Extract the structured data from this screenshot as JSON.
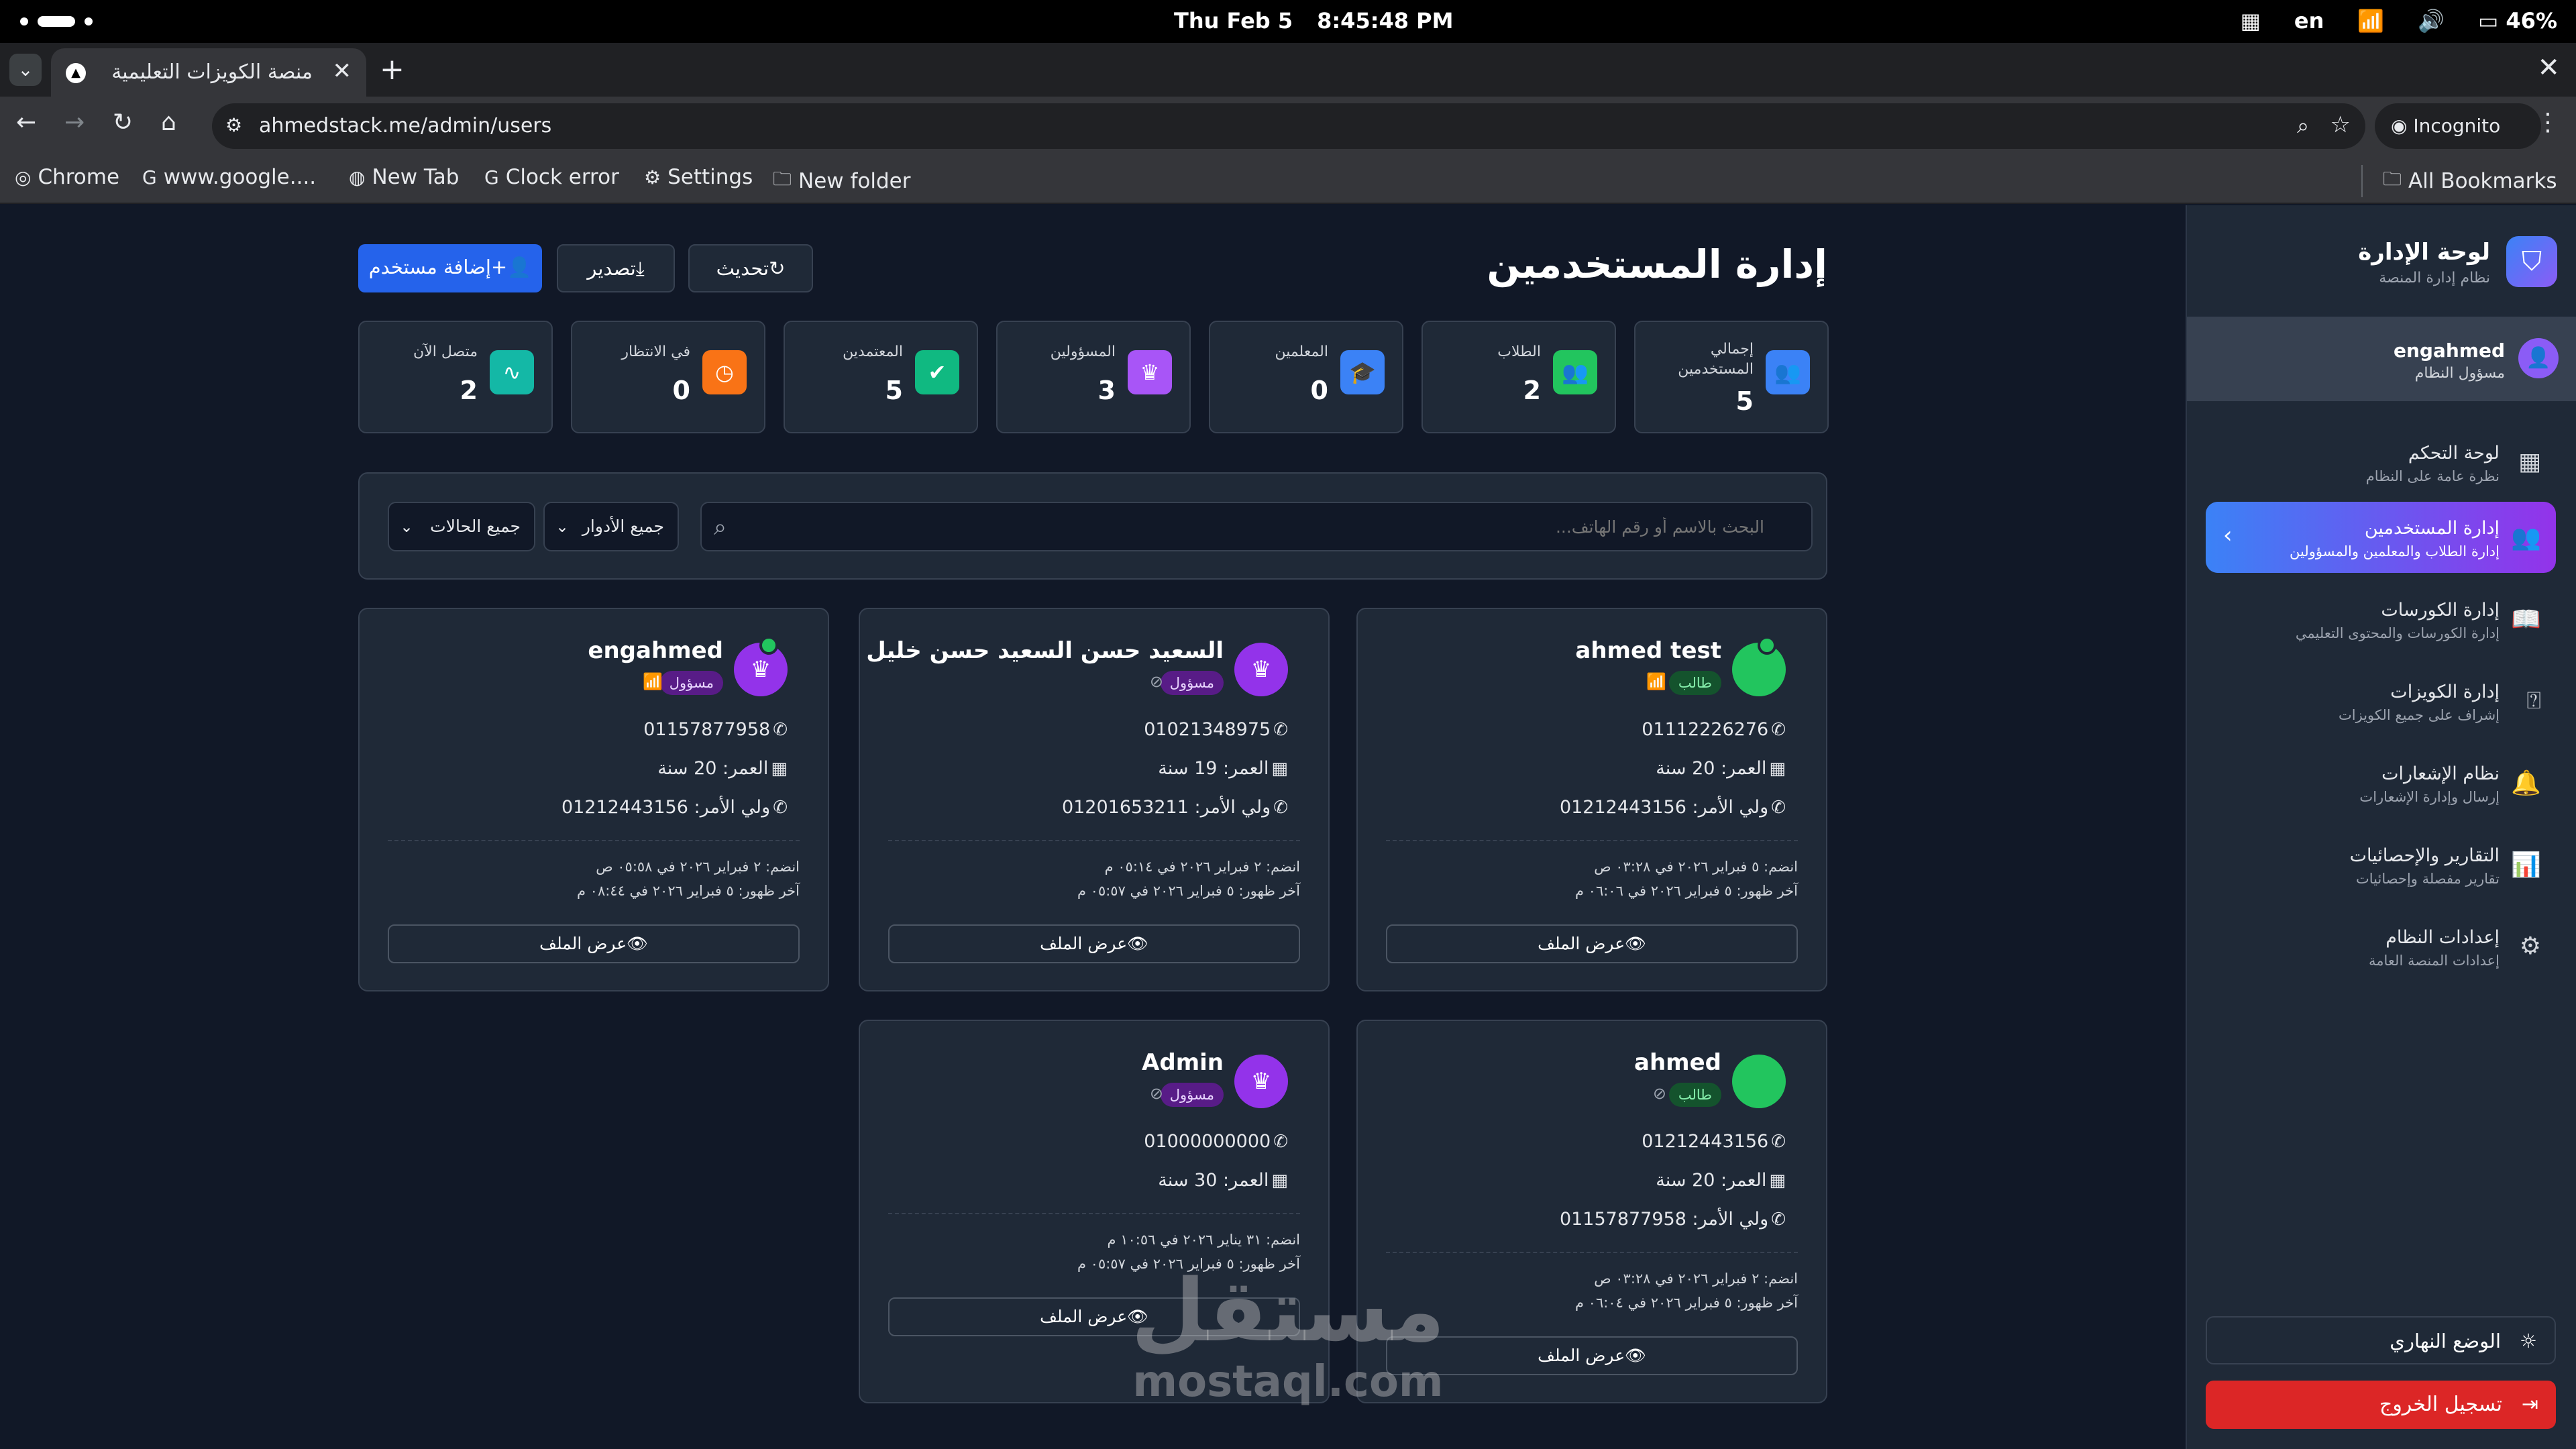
{
  "os": {
    "date": "Thu Feb 5",
    "time": "8:45:48 PM",
    "lang": "en",
    "battery": "46%"
  },
  "browser": {
    "tab_title": "منصة الكويزات التعليمية",
    "url": "ahmedstack.me/admin/users",
    "incognito": "Incognito",
    "bookmarks": [
      "Chrome",
      "www.google....",
      "New Tab",
      "Clock error",
      "Settings",
      "New folder"
    ],
    "all_bookmarks": "All Bookmarks"
  },
  "sidebar": {
    "title": "لوحة الإدارة",
    "subtitle": "نظام إدارة المنصة",
    "user": {
      "name": "engahmed",
      "role": "مسؤول النظام"
    },
    "items": [
      {
        "label": "لوحة التحكم",
        "desc": "نظرة عامة على النظام",
        "icon": "grid-icon",
        "active": false
      },
      {
        "label": "إدارة المستخدمين",
        "desc": "إدارة الطلاب والمعلمين والمسؤولين",
        "icon": "users-icon",
        "active": true
      },
      {
        "label": "إدارة الكورسات",
        "desc": "إدارة الكورسات والمحتوى التعليمي",
        "icon": "book-icon",
        "active": false
      },
      {
        "label": "إدارة الكويزات",
        "desc": "إشراف على جميع الكويزات",
        "icon": "quiz-icon",
        "active": false
      },
      {
        "label": "نظام الإشعارات",
        "desc": "إرسال وإدارة الإشعارات",
        "icon": "bell-icon",
        "active": false
      },
      {
        "label": "التقارير والإحصائيات",
        "desc": "تقارير مفصلة وإحصائيات",
        "icon": "chart-icon",
        "active": false
      },
      {
        "label": "إعدادات النظام",
        "desc": "إعدادات المنصة العامة",
        "icon": "gear-icon",
        "active": false
      }
    ],
    "theme_label": "الوضع النهاري",
    "logout_label": "تسجيل الخروج"
  },
  "header": {
    "title": "إدارة المستخدمين",
    "refresh": "تحديث",
    "export": "تصدير",
    "add_user": "إضافة مستخدم"
  },
  "stats": [
    {
      "label": "إجمالي المستخدمين",
      "value": "5",
      "color": "#3b82f6",
      "icon": "users-icon"
    },
    {
      "label": "الطلاب",
      "value": "2",
      "color": "#22c55e",
      "icon": "users-icon"
    },
    {
      "label": "المعلمين",
      "value": "0",
      "color": "#3b82f6",
      "icon": "graduation-cap-icon"
    },
    {
      "label": "المسؤولين",
      "value": "3",
      "color": "#a855f7",
      "icon": "crown-icon"
    },
    {
      "label": "المعتمدين",
      "value": "5",
      "color": "#10b981",
      "icon": "user-check-icon"
    },
    {
      "label": "في الانتظار",
      "value": "0",
      "color": "#f97316",
      "icon": "clock-icon"
    },
    {
      "label": "متصل الآن",
      "value": "2",
      "color": "#14b8a6",
      "icon": "activity-icon"
    }
  ],
  "filters": {
    "search_placeholder": "البحث بالاسم أو رقم الهاتف...",
    "roles": "جميع الأدوار",
    "statuses": "جميع الحالات"
  },
  "users": [
    {
      "name": "ahmed test",
      "role": "طالب",
      "phone": "01112226276",
      "age": "العمر: 20 سنة",
      "guardian": "ولي الأمر: 01212443156",
      "joined": "انضم: ٥ فبراير ٢٠٢٦ في ٠٣:٢٨ ص",
      "last_seen": "آخر ظهور: ٥ فبراير ٢٠٢٦ في ٠٦:٠٦ م",
      "online": true,
      "view": "عرض الملف"
    },
    {
      "name": "السعيد حسن السعيد حسن خليل",
      "role": "مسؤول",
      "phone": "01021348975",
      "age": "العمر: 19 سنة",
      "guardian": "ولي الأمر: 01201653211",
      "joined": "انضم: ٢ فبراير ٢٠٢٦ في ٠٥:١٤ م",
      "last_seen": "آخر ظهور: ٥ فبراير ٢٠٢٦ في ٠٥:٥٧ م",
      "online": false,
      "view": "عرض الملف"
    },
    {
      "name": "engahmed",
      "role": "مسؤول",
      "phone": "01157877958",
      "age": "العمر: 20 سنة",
      "guardian": "ولي الأمر: 01212443156",
      "joined": "انضم: ٢ فبراير ٢٠٢٦ في ٠٥:٥٨ ص",
      "last_seen": "آخر ظهور: ٥ فبراير ٢٠٢٦ في ٠٨:٤٤ م",
      "online": true,
      "view": "عرض الملف"
    },
    {
      "name": "ahmed",
      "role": "طالب",
      "phone": "01212443156",
      "age": "العمر: 20 سنة",
      "guardian": "ولي الأمر: 01157877958",
      "joined": "انضم: ٢ فبراير ٢٠٢٦ في ٠٣:٢٨ ص",
      "last_seen": "آخر ظهور: ٥ فبراير ٢٠٢٦ في ٠٦:٠٤ م",
      "online": false,
      "view": "عرض الملف"
    },
    {
      "name": "Admin",
      "role": "مسؤول",
      "phone": "01000000000",
      "age": "العمر: 30 سنة",
      "guardian": "",
      "joined": "انضم: ٣١ يناير ٢٠٢٦ في ١٠:٥٦ م",
      "last_seen": "آخر ظهور: ٥ فبراير ٢٠٢٦ في ٠٥:٥٧ م",
      "online": false,
      "view": "عرض الملف"
    }
  ],
  "watermark": {
    "ar": "مستقل",
    "en": "mostaql.com"
  }
}
